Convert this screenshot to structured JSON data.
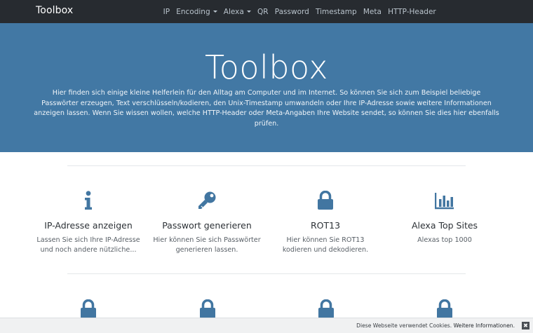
{
  "navbar": {
    "brand": "Toolbox",
    "items": [
      {
        "label": "IP",
        "dropdown": false
      },
      {
        "label": "Encoding",
        "dropdown": true
      },
      {
        "label": "Alexa",
        "dropdown": true
      },
      {
        "label": "QR",
        "dropdown": false
      },
      {
        "label": "Password",
        "dropdown": false
      },
      {
        "label": "Timestamp",
        "dropdown": false
      },
      {
        "label": "Meta",
        "dropdown": false
      },
      {
        "label": "HTTP-Header",
        "dropdown": false
      }
    ]
  },
  "hero": {
    "title": "Toolbox",
    "text": "Hier finden sich einige kleine Helferlein für den Alltag am Computer und im Internet. So können Sie sich zum Beispiel beliebige Passwörter erzeugen, Text verschlüsseln/kodieren, den Unix-Timestamp umwandeln oder Ihre IP-Adresse sowie weitere Informationen anzeigen lassen. Wenn Sie wissen wollen, welche HTTP-Header oder Meta-Angaben Ihre Website sendet, so können Sie dies hier ebenfalls prüfen."
  },
  "cards": [
    {
      "icon": "info-icon",
      "title": "IP-Adresse anzeigen",
      "text": "Lassen Sie sich Ihre IP-Adresse und noch andere nützliche..."
    },
    {
      "icon": "key-icon",
      "title": "Passwort generieren",
      "text": "Hier können Sie sich Passwörter generieren lassen."
    },
    {
      "icon": "lock-icon",
      "title": "ROT13",
      "text": "Hier können Sie ROT13 kodieren und dekodieren."
    },
    {
      "icon": "bar-chart-icon",
      "title": "Alexa Top Sites",
      "text": "Alexas top 1000"
    }
  ],
  "second_row_icons": [
    "lock-icon",
    "lock-icon",
    "lock-icon",
    "lock-icon"
  ],
  "cookie": {
    "message": "Diese Webseite verwendet Cookies.",
    "link": "Weitere Informationen.",
    "close": "✖"
  },
  "colors": {
    "navbar": "#272b30",
    "hero": "#4278a4",
    "icon": "#4276a1"
  }
}
